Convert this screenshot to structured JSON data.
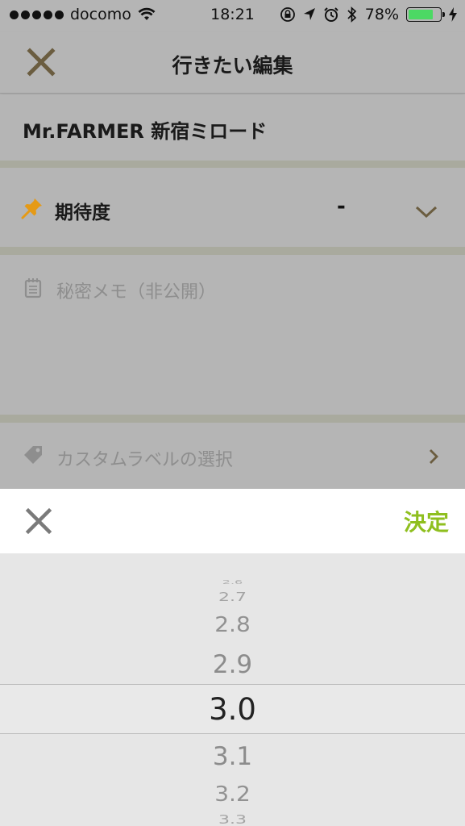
{
  "status_bar": {
    "carrier": "docomo",
    "time": "18:21",
    "battery_text": "78%",
    "battery_level": 0.78,
    "icons": [
      "signal-dots-icon",
      "wifi-icon",
      "rotation-lock-icon",
      "location-arrow-icon",
      "alarm-icon",
      "bluetooth-icon",
      "battery-icon",
      "charging-bolt-icon"
    ]
  },
  "header": {
    "title": "行きたい編集",
    "close_icon": "close-icon"
  },
  "shop": {
    "name": "Mr.FARMER 新宿ミロード"
  },
  "expectation": {
    "icon": "pin-icon",
    "label": "期待度",
    "value": "-",
    "chevron": "chevron-down-icon"
  },
  "memo": {
    "icon": "memo-icon",
    "placeholder": "秘密メモ（非公開）"
  },
  "custom_label": {
    "icon": "tag-icon",
    "text": "カスタムラベルの選択",
    "chevron": "chevron-right-icon"
  },
  "picker": {
    "close_icon": "close-icon",
    "done_label": "決定",
    "options": [
      "2.6",
      "2.7",
      "2.8",
      "2.9",
      "3.0",
      "3.1",
      "3.2",
      "3.3"
    ],
    "selected": "3.0"
  },
  "colors": {
    "accent": "#8fbf1f",
    "pin": "#e59a16",
    "overlay": "#b5b5b5"
  }
}
